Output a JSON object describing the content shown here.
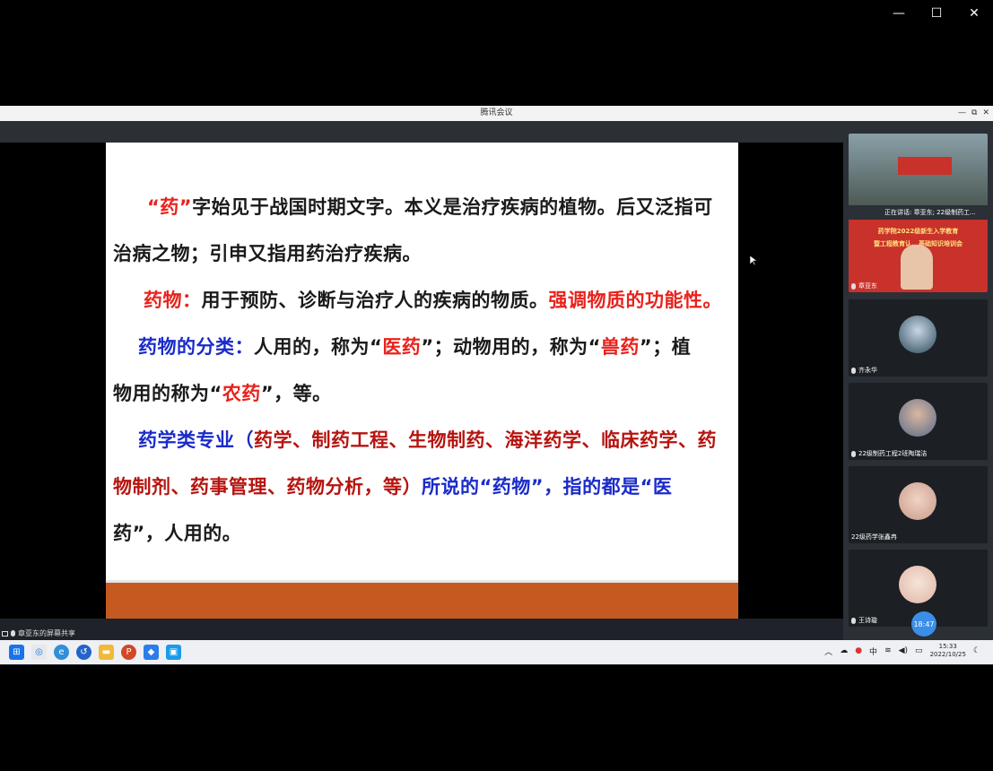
{
  "window": {
    "title": "腾讯会议",
    "outer_controls": [
      "—",
      "☐",
      "✕"
    ],
    "inner_controls": [
      "—",
      "⧉",
      "✕"
    ]
  },
  "slide": {
    "p1": {
      "a": "“药”",
      "b": "字始见于战国时期文字。本义是治疗疾病的植物。后又泛指可"
    },
    "p1b": "治病之物；引申又指用药治疗疾病。",
    "p2": {
      "a": "药物：",
      "b": "用于预防、诊断与治疗人的疾病的物质。",
      "c": "强调物质的功能性。"
    },
    "p3": {
      "a": "药物的分类：",
      "b": "人用的，称为“",
      "c": "医药",
      "d": "”；动物用的，称为“",
      "e": "兽药",
      "f": "”；植"
    },
    "p3b": {
      "a": "物用的称为“",
      "b": "农药",
      "c": "”，等。"
    },
    "p4": {
      "a": "药学类专业（",
      "b": "药学、制药工程、生物制药、海洋药学、临床药学、药"
    },
    "p4b": {
      "a": "物制剂、药事管理、药物分析，等）",
      "b": "所说的“药物”，指的都是“医"
    },
    "p4c": "药”，人用的。"
  },
  "sidebar": {
    "speaking": "正在讲话: 章亚东; 22级制药工...",
    "banner_line1": "药学院2022级新生入学教育",
    "banner_line2": "暨工程教育认...基础知识培训会",
    "participants": [
      {
        "name": "章亚东"
      },
      {
        "name": "齐永华"
      },
      {
        "name": "22级制药工程2班陶瑞洁"
      },
      {
        "name": "22级药学张鑫冉"
      },
      {
        "name": "王诗璇"
      }
    ]
  },
  "share_label": "章亚东的屏幕共享",
  "timer": "18:47",
  "tray": {
    "ime": "中",
    "time": "15:33",
    "date": "2022/10/25"
  },
  "colors": {
    "accent": "#3a8ee6",
    "slide_footer": "#c55a20",
    "red_text": "#e8221c",
    "blue_text": "#1a2bc9"
  }
}
